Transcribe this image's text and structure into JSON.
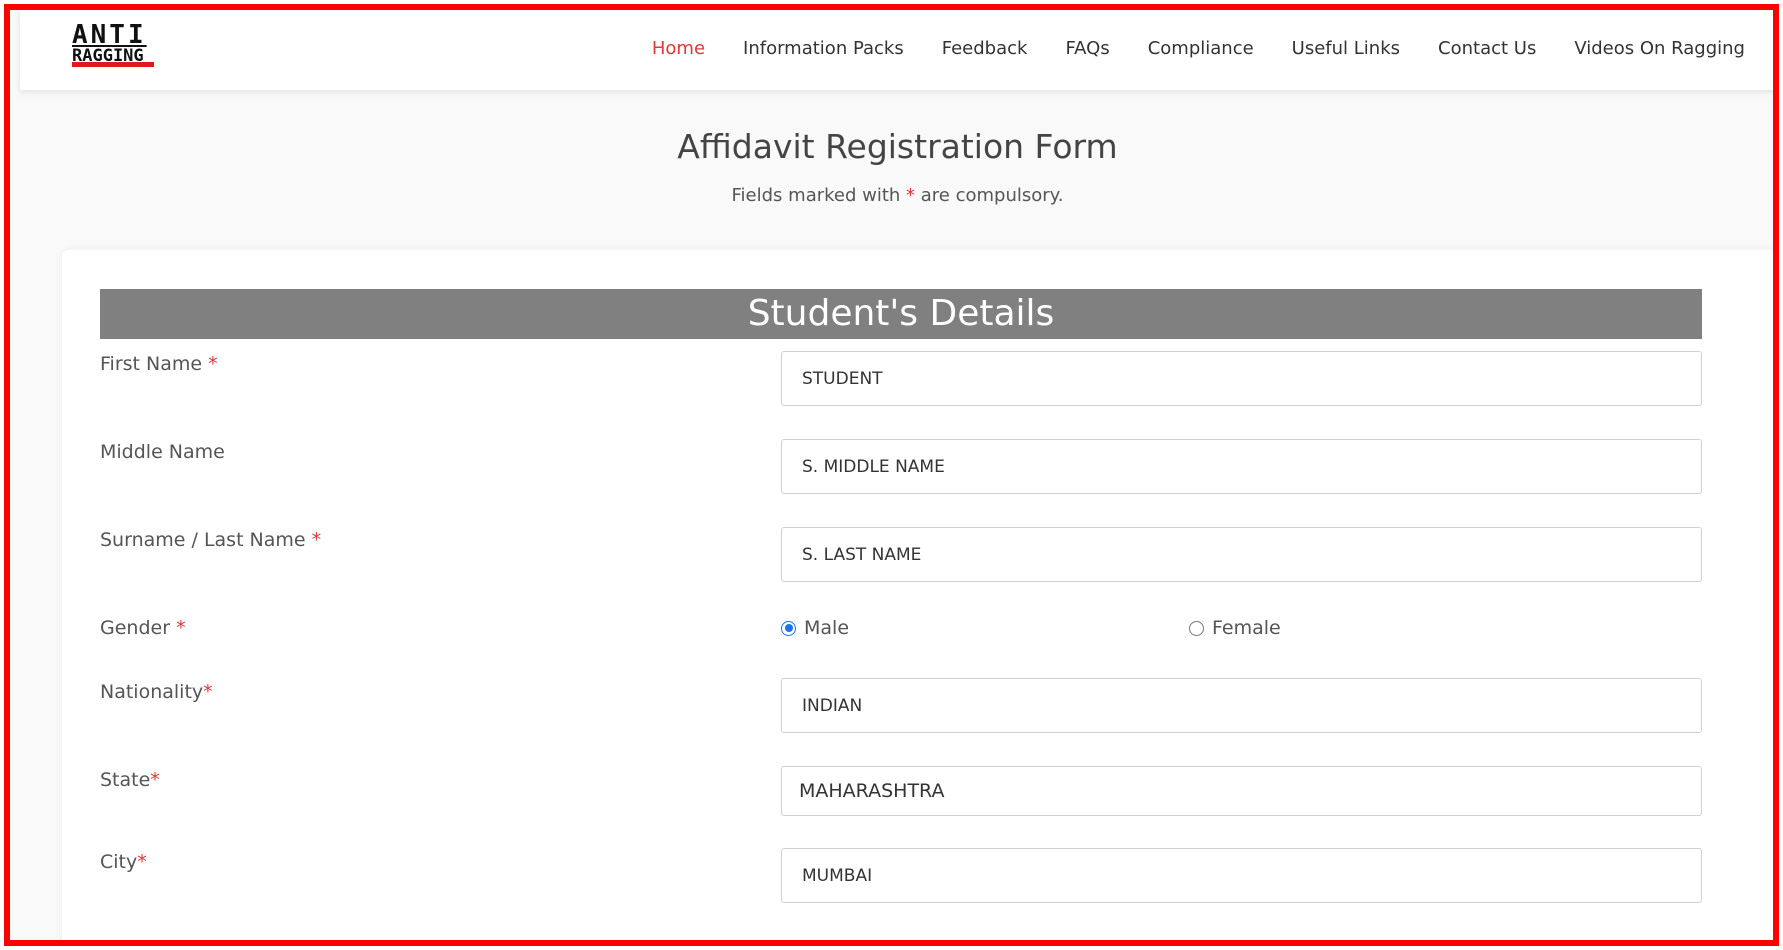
{
  "logo": {
    "line1": "ANTI",
    "line2": "RAGGING"
  },
  "nav": {
    "items": [
      {
        "label": "Home",
        "active": true
      },
      {
        "label": "Information Packs",
        "active": false
      },
      {
        "label": "Feedback",
        "active": false
      },
      {
        "label": "FAQs",
        "active": false
      },
      {
        "label": "Compliance",
        "active": false
      },
      {
        "label": "Useful Links",
        "active": false
      },
      {
        "label": "Contact Us",
        "active": false
      },
      {
        "label": "Videos On Ragging",
        "active": false
      }
    ]
  },
  "page": {
    "title": "Affidavit Registration Form",
    "subtitle_pre": "Fields marked with ",
    "subtitle_star": "*",
    "subtitle_post": " are compulsory."
  },
  "section": {
    "title": "Student's Details"
  },
  "form": {
    "first_name": {
      "label": "First Name ",
      "star": "*",
      "value": "STUDENT"
    },
    "middle_name": {
      "label": "Middle Name",
      "value": "S. MIDDLE NAME"
    },
    "last_name": {
      "label": "Surname / Last Name ",
      "star": "*",
      "value": "S. LAST NAME"
    },
    "gender": {
      "label": "Gender ",
      "star": "*",
      "options": [
        {
          "label": "Male",
          "checked": true
        },
        {
          "label": "Female",
          "checked": false
        }
      ]
    },
    "nationality": {
      "label": "Nationality",
      "star": "*",
      "value": "INDIAN"
    },
    "state": {
      "label": "State",
      "star": "*",
      "value": "MAHARASHTRA"
    },
    "city": {
      "label": "City",
      "star": "*",
      "value": "MUMBAI"
    }
  },
  "colors": {
    "accent": "#e0373a",
    "frame": "#ff0000",
    "section_bg": "#808080",
    "radio": "#1a73e8"
  }
}
